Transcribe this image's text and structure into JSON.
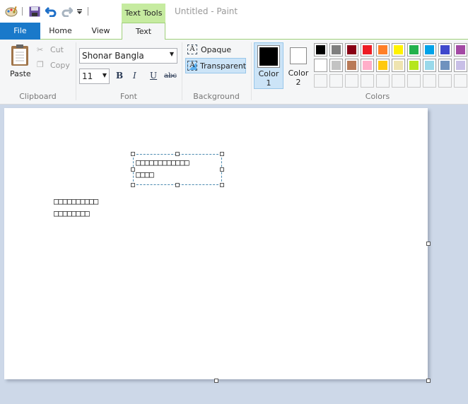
{
  "window": {
    "title": "Untitled - Paint",
    "contextual_tab_group": "Text Tools"
  },
  "tabs": [
    {
      "label": "File"
    },
    {
      "label": "Home"
    },
    {
      "label": "View"
    },
    {
      "label": "Text"
    }
  ],
  "clipboard": {
    "paste": "Paste",
    "cut": "Cut",
    "copy": "Copy",
    "group": "Clipboard"
  },
  "font": {
    "family": "Shonar Bangla",
    "size": "11",
    "group": "Font",
    "bold": "B",
    "italic": "I",
    "underline": "U",
    "strike": "abc"
  },
  "background": {
    "opaque": "Opaque",
    "transparent": "Transparent",
    "selected": "Transparent",
    "group": "Background"
  },
  "colors": {
    "color1_label": "Color",
    "color1_num": "1",
    "color2_label": "Color",
    "color2_num": "2",
    "group": "Colors",
    "color1": "#000000",
    "color2": "#ffffff",
    "palette_row1": [
      "#000000",
      "#7f7f7f",
      "#880015",
      "#ed1c24",
      "#ff7f27",
      "#fff200",
      "#22b14c",
      "#00a2e8",
      "#3f48cc",
      "#a349a4"
    ],
    "palette_row2": [
      "#ffffff",
      "#c3c3c3",
      "#b97a57",
      "#ffaec9",
      "#ffc90e",
      "#efe4b0",
      "#b5e61d",
      "#99d9ea",
      "#7092be",
      "#c8bfe7"
    ]
  },
  "canvas": {
    "textbox_lines": [
      "□□□□□□□□□□□□",
      "□□□□"
    ],
    "text_lines": [
      "□□□□□□□□□□",
      "□□□□□□□□"
    ]
  }
}
